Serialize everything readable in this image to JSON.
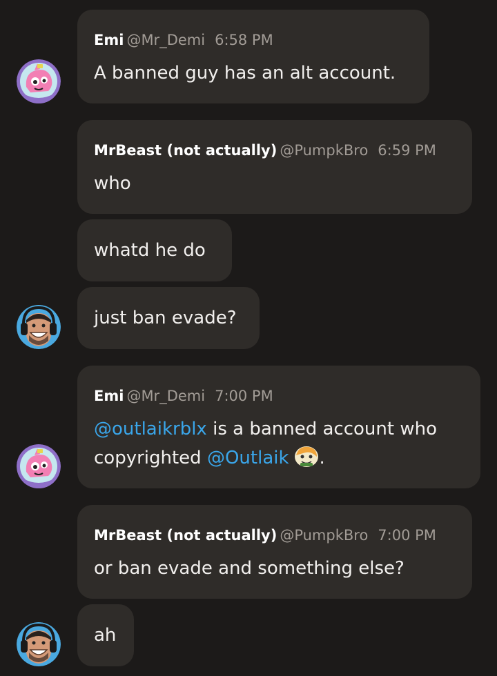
{
  "messages": [
    {
      "author": "Emi",
      "handle": "@Mr_Demi",
      "time": "6:58 PM",
      "text": "A banned guy has an alt account."
    },
    {
      "author": "MrBeast (not actually)",
      "handle": "@PumpkBro",
      "time": "6:59 PM",
      "text": "who"
    },
    {
      "text": "whatd he do"
    },
    {
      "text": "just ban evade?"
    },
    {
      "author": "Emi",
      "handle": "@Mr_Demi",
      "time": "7:00 PM",
      "line1_mention": "@outlaikrblx",
      "line1_rest": " is a banned account who",
      "line2_prefix": "copyrighted ",
      "line2_mention": "@Outlaik",
      "line2_suffix": "."
    },
    {
      "author": "MrBeast (not actually)",
      "handle": "@PumpkBro",
      "time": "7:00 PM",
      "text": "or ban evade and something else?"
    },
    {
      "text": "ah"
    }
  ],
  "colors": {
    "background": "#1c1a19",
    "bubble": "#2f2c29",
    "mention": "#3aa6ea",
    "meta": "#a29c96"
  },
  "icons": {
    "emi_avatar": "pink-cartoon-avatar-icon",
    "mrbeast_avatar": "mrbeast-headset-avatar-icon",
    "custom_emoji": "hamster-emoji-icon"
  }
}
